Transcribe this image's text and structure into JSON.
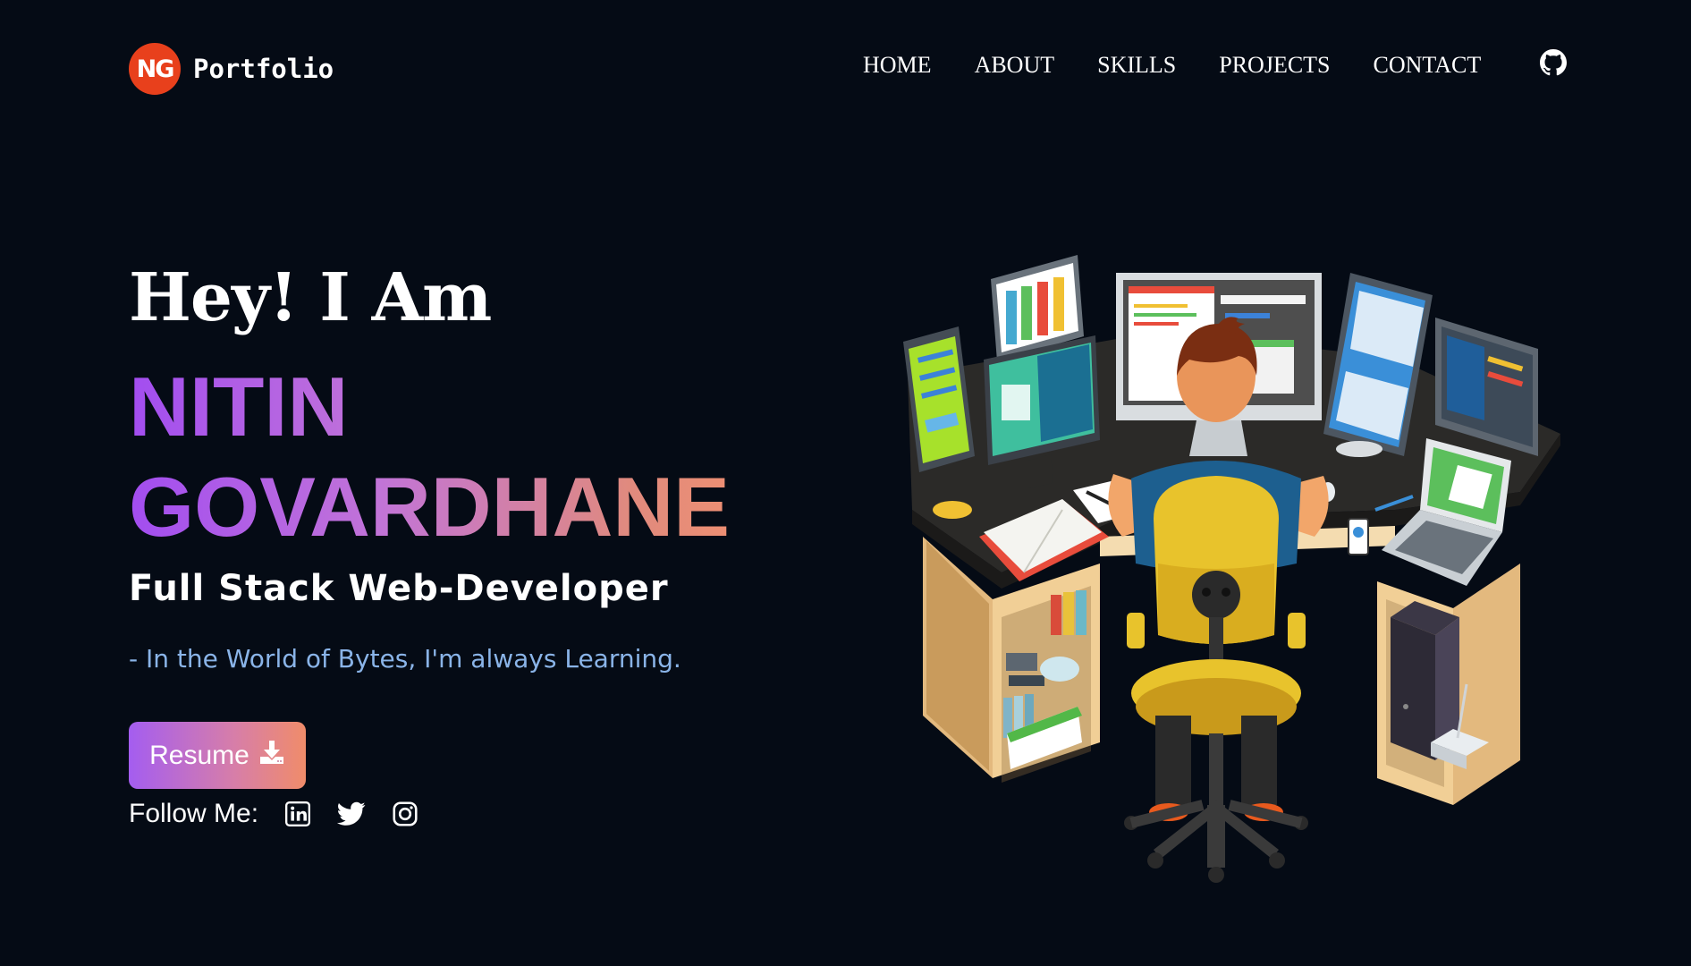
{
  "brand": {
    "logo_text": "NG",
    "name": "Portfolio"
  },
  "nav": {
    "items": [
      {
        "label": "HOME"
      },
      {
        "label": "ABOUT"
      },
      {
        "label": "SKILLS"
      },
      {
        "label": "PROJECTS"
      },
      {
        "label": "CONTACT"
      }
    ],
    "github_icon": "github-icon"
  },
  "hero": {
    "greeting": "Hey! I Am",
    "first_name": "NITIN",
    "last_name": "GOVARDHANE",
    "role": "Full Stack Web-Developer",
    "tagline": "- In the World of Bytes, I'm always Learning.",
    "resume_label": "Resume",
    "resume_icon": "download-icon",
    "follow_label": "Follow Me:",
    "socials": [
      "linkedin-icon",
      "twitter-icon",
      "instagram-icon"
    ]
  },
  "colors": {
    "background": "#050b15",
    "logo": "#e8401c",
    "gradient_start": "#a24df0",
    "gradient_end": "#f09070",
    "tagline": "#8ab4e8"
  }
}
